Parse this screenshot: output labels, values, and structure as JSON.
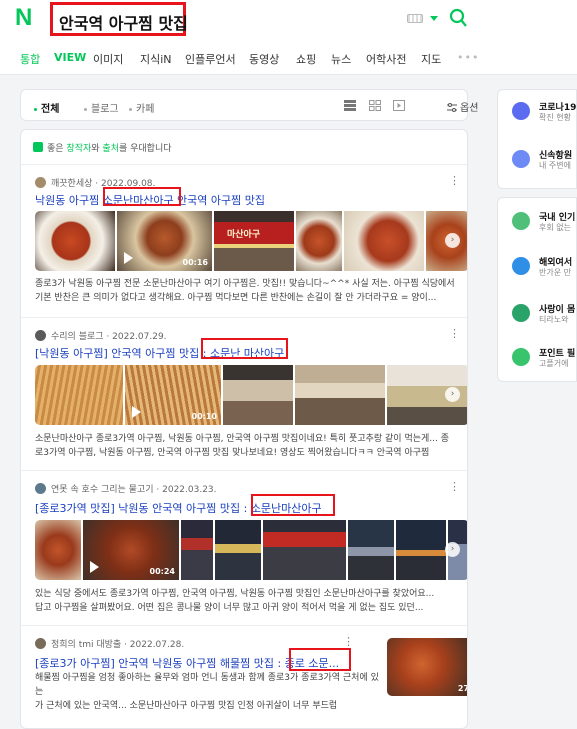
{
  "search": {
    "logo": "N",
    "query": "안국역 아구찜 맛집"
  },
  "tabs": [
    "통합",
    "VIEW",
    "이미지",
    "지식iN",
    "인플루언서",
    "동영상",
    "쇼핑",
    "뉴스",
    "어학사전",
    "지도"
  ],
  "filters": {
    "all": "전체",
    "blog": "블로그",
    "cafe": "카페",
    "options": "옵션"
  },
  "notice": {
    "prefix": "좋은 ",
    "creator": "창작자",
    "middle": "와 ",
    "source": "출처",
    "suffix": "를 우대합니다"
  },
  "posts": [
    {
      "author": "깨끗한세상",
      "date": "2022.09.08.",
      "title_prefix": "낙원동 아구찜 ",
      "title_box": "소문난마산아구",
      "title_suffix": " 안국역 아구찜 맛집",
      "duration": "00:16",
      "snippet_line1": "종로3가 낙원동 아구찜 전문 소문난마산아구 여기 아구찜은. 맛집!! 맞습니다~^^* 사실 저는. 아구찜 식당에서",
      "snippet_line2": "기본 반찬은 큰 의미가 없다고 생각해요. 아구찜 먹다보면 다른 반찬에는 손길이 잘 안 가더라구요 = 양이..."
    },
    {
      "author": "수리의 블로그",
      "date": "2022.07.29.",
      "title_prefix": "[낙원동 아구찜] 안국역 아구찜 맛집 : ",
      "title_box": "소문난 마산아구",
      "title_suffix": "",
      "duration": "00:10",
      "snippet_line1": "소문난마산아구 종로3가역 아구찜, 낙원동 아구찜, 안국역 아구찜 맛집이네요! 특히 풋고추랑 같이 먹는게... 종",
      "snippet_line2": "로3가역 아구찜, 낙원동 아구찜, 안국역 아구찜 맛집 맞나보네요! 영상도 찍어왔습니다ㅋㅋ 안국역 아구찜"
    },
    {
      "author": "연못 속 호수 그리는 물고기",
      "date": "2022.03.23.",
      "title_prefix": "[종로3가역 맛집] 낙원동 안국역 아구찜 맛집 : ",
      "title_box": "소문난마산아구",
      "title_suffix": "",
      "duration": "00:24",
      "snippet_line1": "있는 식당 중에서도 종로3가역 아구찜, 안국역 아구찜, 낙원동 아구찜 맛집인 소문난마산아구를 찾았어요...",
      "snippet_line2": "답고 아구찜을 살펴봤어요. 어떤 집은 콩나물 양이 너무 많고 아귀 양이 적어서 먹을 게 없는 집도 있던..."
    },
    {
      "author": "정희의 tmi 대방출",
      "date": "2022.07.28.",
      "title_prefix": "[종로3가 아구찜] 안국역 낙원동 아구찜 해물찜 맛집 : ",
      "title_box": "종로 소문...",
      "title_suffix": "",
      "photo_count": "27",
      "snippet_line1": "해물찜 아구찜을 엄청 좋아하는 율무와 엄마 언니 동생과 함께 종로3가 종로3가역 근처에 있는",
      "snippet_line2": "가 근처에 있는 안국역... 소문난마산아구 아구찜 맛집 인정 아귀살이 너무 부드럽"
    }
  ],
  "side_top": [
    {
      "title": "코로나19",
      "sub": "확진 현황"
    },
    {
      "title": "신속항원",
      "sub": "내 주변에"
    }
  ],
  "side_bottom": [
    {
      "title": "국내 인기",
      "sub": "후회 없는"
    },
    {
      "title": "해외여서",
      "sub": "반가운 만"
    },
    {
      "title": "사랑이 몸",
      "sub": "티라노와"
    },
    {
      "title": "포인트 필",
      "sub": "고플거에"
    }
  ],
  "colors": {
    "brand": "#03c75a",
    "link": "#1a3fbf",
    "highlight_box": "#e8141c"
  }
}
